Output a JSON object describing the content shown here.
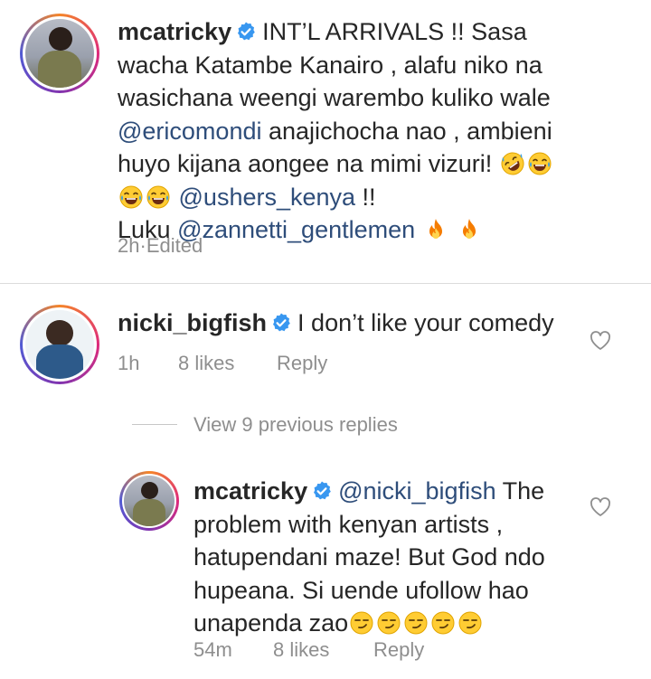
{
  "comments": [
    {
      "username": "mcatricky",
      "text_line1_a": "INT’L ARRIVALS !! Sasa",
      "text_line2": "wacha Katambe Kanairo , alafu niko na",
      "text_line3": "wasichana weengi warembo kuliko wale",
      "mention1": "@ericomondi",
      "text_line4_b": " anajichocha nao , ambieni",
      "text_line5": "huyo kijana aongee na mimi vizuri! ",
      "mention2": "@ushers_kenya",
      "text_line6_b": " !!",
      "text_line7_a": "Luku ",
      "mention3": "@zannetti_gentlemen",
      "time": "2h",
      "separator": " · ",
      "edited": "Edited"
    },
    {
      "username": "nicki_bigfish",
      "text": "I don’t like your comedy",
      "time": "1h",
      "likes": "8 likes",
      "reply": "Reply"
    },
    {
      "username": "mcatricky",
      "mention": "@nicki_bigfish",
      "text_line1_b": " The",
      "text_line2": "problem with kenyan artists ,",
      "text_line3": "hatupendani maze!  But God ndo",
      "text_line4": "hupeana. Si uende ufollow hao",
      "text_line5": "unapenda zao",
      "time": "54m",
      "likes": "8 likes",
      "reply": "Reply"
    }
  ],
  "view_replies": "View 9 previous replies",
  "icons": {
    "verified": "verified-badge-icon",
    "like": "heart-outline-icon",
    "laugh_roll": "rofl-emoji",
    "laugh": "tears-of-joy-emoji",
    "fire": "fire-emoji",
    "smirk": "smirk-emoji"
  },
  "colors": {
    "verified": "#3897f0",
    "mention": "#2e4d7a",
    "meta": "#8e8e8e"
  }
}
